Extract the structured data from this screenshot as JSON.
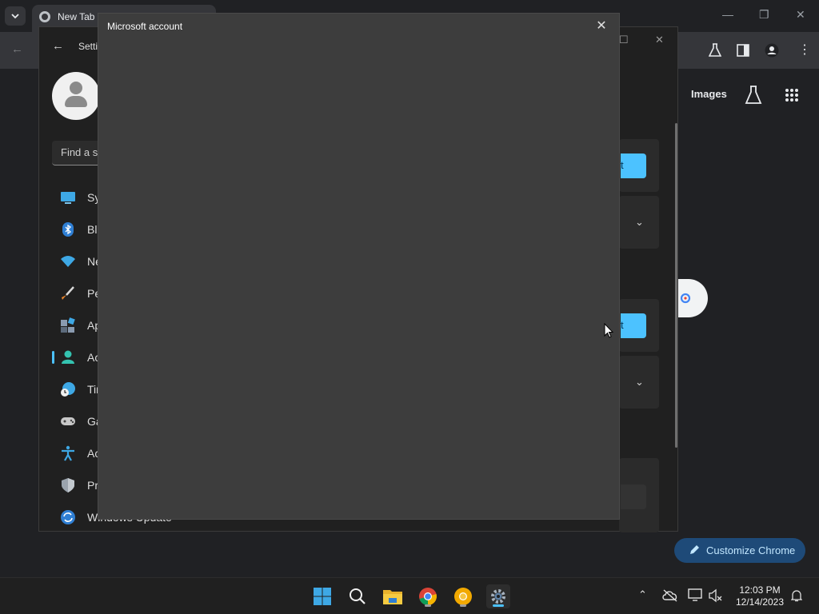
{
  "chrome": {
    "tab_title": "New Tab",
    "images_link": "Images",
    "customize_label": "Customize Chrome"
  },
  "settings": {
    "title": "Setti",
    "search_placeholder": "Find a s",
    "nav_items": [
      {
        "label": "Sy",
        "icon": "system-icon"
      },
      {
        "label": "Bl",
        "icon": "bluetooth-icon"
      },
      {
        "label": "Ne",
        "icon": "network-icon"
      },
      {
        "label": "Pe",
        "icon": "personalization-icon"
      },
      {
        "label": "Ap",
        "icon": "apps-icon"
      },
      {
        "label": "Ac",
        "icon": "accounts-icon",
        "active": true
      },
      {
        "label": "Tir",
        "icon": "time-language-icon"
      },
      {
        "label": "Ga",
        "icon": "gaming-icon"
      },
      {
        "label": "Ac",
        "icon": "accessibility-icon"
      },
      {
        "label": "Pr",
        "icon": "privacy-icon"
      },
      {
        "label": "Windows Update",
        "icon": "windows-update-icon"
      }
    ],
    "button_fragment": "t"
  },
  "dialog": {
    "title": "Microsoft account"
  },
  "taskbar": {
    "time": "12:03 PM",
    "date": "12/14/2023"
  },
  "colors": {
    "accent": "#4cc2ff",
    "dialog_bg": "#3d3d3d",
    "settings_bg": "#202020",
    "chrome_bg": "#202124"
  }
}
